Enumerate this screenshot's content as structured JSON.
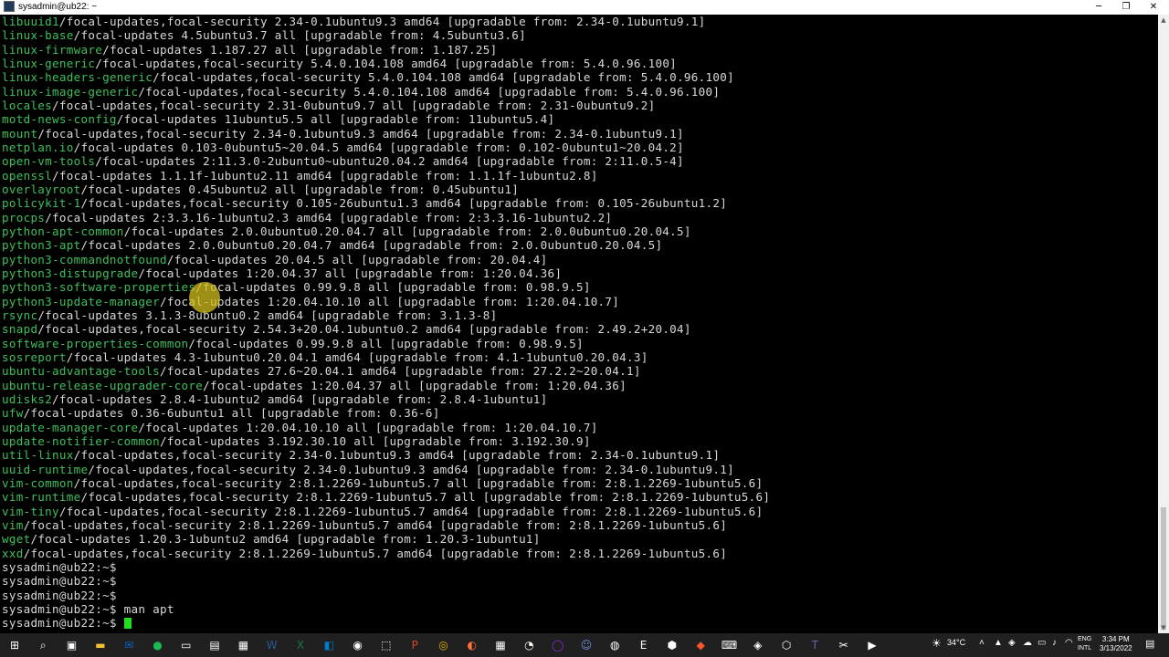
{
  "window": {
    "title": "sysadmin@ub22: ~",
    "minimize_glyph": "─",
    "maximize_glyph": "❐",
    "close_glyph": "✕"
  },
  "terminal": {
    "lines": [
      {
        "pkg": "libuuid1",
        "rest": "/focal-updates,focal-security 2.34-0.1ubuntu9.3 amd64 [upgradable from: 2.34-0.1ubuntu9.1]"
      },
      {
        "pkg": "linux-base",
        "rest": "/focal-updates 4.5ubuntu3.7 all [upgradable from: 4.5ubuntu3.6]"
      },
      {
        "pkg": "linux-firmware",
        "rest": "/focal-updates 1.187.27 all [upgradable from: 1.187.25]"
      },
      {
        "pkg": "linux-generic",
        "rest": "/focal-updates,focal-security 5.4.0.104.108 amd64 [upgradable from: 5.4.0.96.100]"
      },
      {
        "pkg": "linux-headers-generic",
        "rest": "/focal-updates,focal-security 5.4.0.104.108 amd64 [upgradable from: 5.4.0.96.100]"
      },
      {
        "pkg": "linux-image-generic",
        "rest": "/focal-updates,focal-security 5.4.0.104.108 amd64 [upgradable from: 5.4.0.96.100]"
      },
      {
        "pkg": "locales",
        "rest": "/focal-updates,focal-security 2.31-0ubuntu9.7 all [upgradable from: 2.31-0ubuntu9.2]"
      },
      {
        "pkg": "motd-news-config",
        "rest": "/focal-updates 11ubuntu5.5 all [upgradable from: 11ubuntu5.4]"
      },
      {
        "pkg": "mount",
        "rest": "/focal-updates,focal-security 2.34-0.1ubuntu9.3 amd64 [upgradable from: 2.34-0.1ubuntu9.1]"
      },
      {
        "pkg": "netplan.io",
        "rest": "/focal-updates 0.103-0ubuntu5~20.04.5 amd64 [upgradable from: 0.102-0ubuntu1~20.04.2]"
      },
      {
        "pkg": "open-vm-tools",
        "rest": "/focal-updates 2:11.3.0-2ubuntu0~ubuntu20.04.2 amd64 [upgradable from: 2:11.0.5-4]"
      },
      {
        "pkg": "openssl",
        "rest": "/focal-updates 1.1.1f-1ubuntu2.11 amd64 [upgradable from: 1.1.1f-1ubuntu2.8]"
      },
      {
        "pkg": "overlayroot",
        "rest": "/focal-updates 0.45ubuntu2 all [upgradable from: 0.45ubuntu1]"
      },
      {
        "pkg": "policykit-1",
        "rest": "/focal-updates,focal-security 0.105-26ubuntu1.3 amd64 [upgradable from: 0.105-26ubuntu1.2]"
      },
      {
        "pkg": "procps",
        "rest": "/focal-updates 2:3.3.16-1ubuntu2.3 amd64 [upgradable from: 2:3.3.16-1ubuntu2.2]"
      },
      {
        "pkg": "python-apt-common",
        "rest": "/focal-updates 2.0.0ubuntu0.20.04.7 all [upgradable from: 2.0.0ubuntu0.20.04.5]"
      },
      {
        "pkg": "python3-apt",
        "rest": "/focal-updates 2.0.0ubuntu0.20.04.7 amd64 [upgradable from: 2.0.0ubuntu0.20.04.5]"
      },
      {
        "pkg": "python3-commandnotfound",
        "rest": "/focal-updates 20.04.5 all [upgradable from: 20.04.4]"
      },
      {
        "pkg": "python3-distupgrade",
        "rest": "/focal-updates 1:20.04.37 all [upgradable from: 1:20.04.36]"
      },
      {
        "pkg": "python3-software-properties",
        "rest": "/focal-updates 0.99.9.8 all [upgradable from: 0.98.9.5]"
      },
      {
        "pkg": "python3-update-manager",
        "rest": "/focal-updates 1:20.04.10.10 all [upgradable from: 1:20.04.10.7]"
      },
      {
        "pkg": "rsync",
        "rest": "/focal-updates 3.1.3-8ubuntu0.2 amd64 [upgradable from: 3.1.3-8]"
      },
      {
        "pkg": "snapd",
        "rest": "/focal-updates,focal-security 2.54.3+20.04.1ubuntu0.2 amd64 [upgradable from: 2.49.2+20.04]"
      },
      {
        "pkg": "software-properties-common",
        "rest": "/focal-updates 0.99.9.8 all [upgradable from: 0.98.9.5]"
      },
      {
        "pkg": "sosreport",
        "rest": "/focal-updates 4.3-1ubuntu0.20.04.1 amd64 [upgradable from: 4.1-1ubuntu0.20.04.3]"
      },
      {
        "pkg": "ubuntu-advantage-tools",
        "rest": "/focal-updates 27.6~20.04.1 amd64 [upgradable from: 27.2.2~20.04.1]"
      },
      {
        "pkg": "ubuntu-release-upgrader-core",
        "rest": "/focal-updates 1:20.04.37 all [upgradable from: 1:20.04.36]"
      },
      {
        "pkg": "udisks2",
        "rest": "/focal-updates 2.8.4-1ubuntu2 amd64 [upgradable from: 2.8.4-1ubuntu1]"
      },
      {
        "pkg": "ufw",
        "rest": "/focal-updates 0.36-6ubuntu1 all [upgradable from: 0.36-6]"
      },
      {
        "pkg": "update-manager-core",
        "rest": "/focal-updates 1:20.04.10.10 all [upgradable from: 1:20.04.10.7]"
      },
      {
        "pkg": "update-notifier-common",
        "rest": "/focal-updates 3.192.30.10 all [upgradable from: 3.192.30.9]"
      },
      {
        "pkg": "util-linux",
        "rest": "/focal-updates,focal-security 2.34-0.1ubuntu9.3 amd64 [upgradable from: 2.34-0.1ubuntu9.1]"
      },
      {
        "pkg": "uuid-runtime",
        "rest": "/focal-updates,focal-security 2.34-0.1ubuntu9.3 amd64 [upgradable from: 2.34-0.1ubuntu9.1]"
      },
      {
        "pkg": "vim-common",
        "rest": "/focal-updates,focal-security 2:8.1.2269-1ubuntu5.7 all [upgradable from: 2:8.1.2269-1ubuntu5.6]"
      },
      {
        "pkg": "vim-runtime",
        "rest": "/focal-updates,focal-security 2:8.1.2269-1ubuntu5.7 all [upgradable from: 2:8.1.2269-1ubuntu5.6]"
      },
      {
        "pkg": "vim-tiny",
        "rest": "/focal-updates,focal-security 2:8.1.2269-1ubuntu5.7 amd64 [upgradable from: 2:8.1.2269-1ubuntu5.6]"
      },
      {
        "pkg": "vim",
        "rest": "/focal-updates,focal-security 2:8.1.2269-1ubuntu5.7 amd64 [upgradable from: 2:8.1.2269-1ubuntu5.6]"
      },
      {
        "pkg": "wget",
        "rest": "/focal-updates 1.20.3-1ubuntu2 amd64 [upgradable from: 1.20.3-1ubuntu1]"
      },
      {
        "pkg": "xxd",
        "rest": "/focal-updates,focal-security 2:8.1.2269-1ubuntu5.7 amd64 [upgradable from: 2:8.1.2269-1ubuntu5.6]"
      },
      {
        "pkg": "",
        "rest": "sysadmin@ub22:~$"
      },
      {
        "pkg": "",
        "rest": "sysadmin@ub22:~$"
      },
      {
        "pkg": "",
        "rest": "sysadmin@ub22:~$"
      },
      {
        "pkg": "",
        "rest": "sysadmin@ub22:~$ man apt"
      }
    ],
    "prompt": "sysadmin@ub22:~$ ",
    "package_color": "#3fbf5b",
    "text_color": "#d8d8d8",
    "cursor_color": "#1ee01e"
  },
  "taskbar": {
    "icons": [
      "windows-start",
      "search",
      "task-view",
      "file-explorer",
      "mail",
      "spotify",
      "terminal",
      "notepad",
      "calculator",
      "word",
      "excel",
      "vscode",
      "github",
      "screenshot",
      "powerpoint",
      "chrome",
      "firefox",
      "remote-desktop",
      "steam",
      "obs",
      "discord",
      "browser-alt",
      "epic-games",
      "vpn",
      "brave",
      "putty",
      "network-tool",
      "virtualbox",
      "teams",
      "snip-tool",
      "media"
    ],
    "weather": "34°C",
    "language_top": "ENG",
    "language_bottom": "INTL",
    "time": "3:34 PM",
    "date": "3/13/2022"
  }
}
